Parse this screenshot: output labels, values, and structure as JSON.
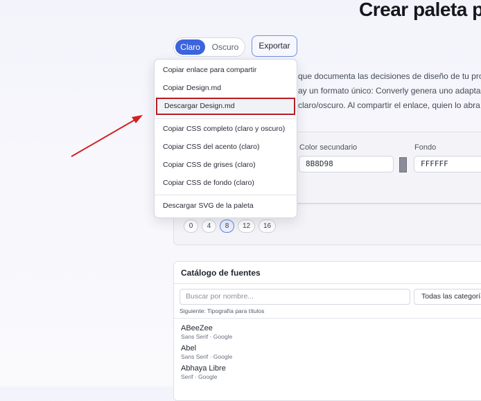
{
  "page": {
    "title": "Crear paleta pe"
  },
  "mode_toggle": {
    "light": "Claro",
    "dark": "Oscuro"
  },
  "export_button": "Exportar",
  "intro_lines": [
    "que documenta las decisiones de diseño de tu proyect",
    "ay un formato único: Converly genera uno adaptado a c",
    "claro/oscuro. Al compartir el enlace, quien lo abra pod"
  ],
  "colors": {
    "secondary_label": "Color secundario",
    "secondary_value": "8B8D98",
    "background_label": "Fondo",
    "background_value": "FFFFFF",
    "secondary_swatch": "#8B8D98"
  },
  "spacing_chips": [
    "0",
    "4",
    "8",
    "12",
    "16"
  ],
  "spacing_selected": "8",
  "export_menu": {
    "items": [
      "Copiar enlace para compartir",
      "Copiar Design.md",
      "Descargar Design.md",
      "Copiar CSS completo (claro y oscuro)",
      "Copiar CSS del acento (claro)",
      "Copiar CSS de grises (claro)",
      "Copiar CSS de fondo (claro)",
      "Descargar SVG de la paleta"
    ],
    "highlighted": "Descargar Design.md"
  },
  "font_catalog": {
    "title": "Catálogo de fuentes",
    "search_placeholder": "Buscar por nombre...",
    "category_select": "Todas las categoría",
    "hint": "Siguiente: Tipografía para títulos",
    "fonts": [
      {
        "name": "ABeeZee",
        "meta": "Sans Serif · Google"
      },
      {
        "name": "Abel",
        "meta": "Sans Serif · Google"
      },
      {
        "name": "Abhaya Libre",
        "meta": "Serif · Google"
      }
    ]
  },
  "accent_color": "#3D63DD",
  "annotation_color": "#D42020"
}
